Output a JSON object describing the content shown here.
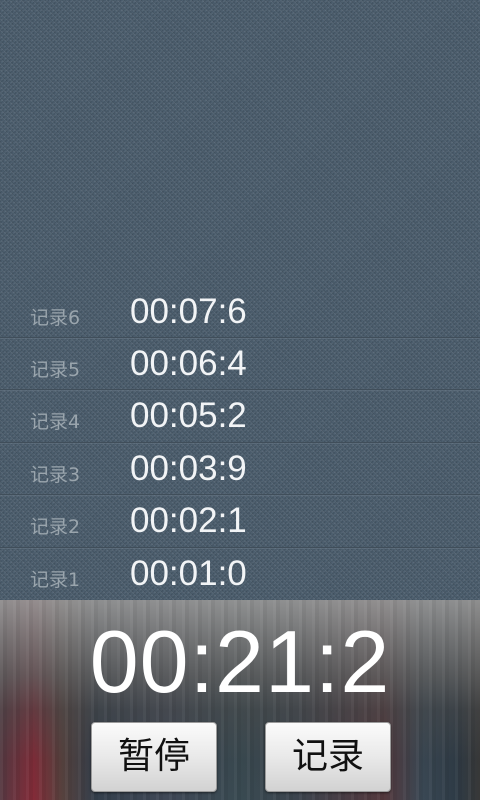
{
  "records": [
    {
      "label": "记录6",
      "time": "00:07:6"
    },
    {
      "label": "记录5",
      "time": "00:06:4"
    },
    {
      "label": "记录4",
      "time": "00:05:2"
    },
    {
      "label": "记录3",
      "time": "00:03:9"
    },
    {
      "label": "记录2",
      "time": "00:02:1"
    },
    {
      "label": "记录1",
      "time": "00:01:0"
    }
  ],
  "timer": {
    "display": "00:21:2"
  },
  "buttons": {
    "pause_label": "暂停",
    "record_label": "记录"
  },
  "colors": {
    "background": "#4a5c6c",
    "label_text": "#9aa5ad",
    "time_text": "#f2f4f6"
  }
}
